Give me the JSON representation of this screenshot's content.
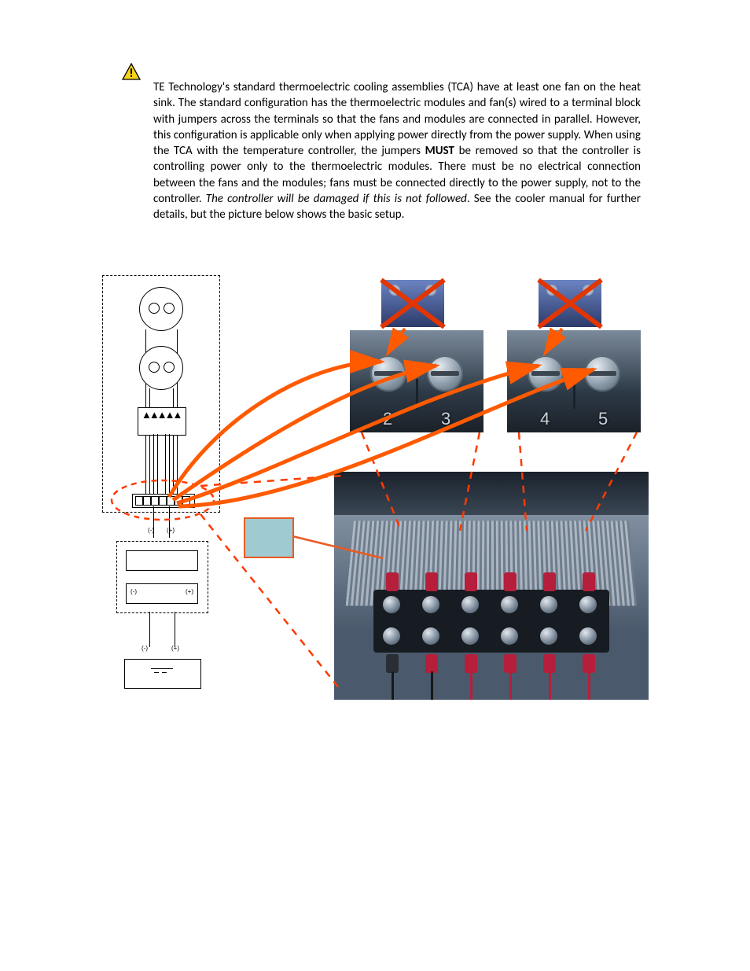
{
  "paragraph": {
    "pre": " TE Technology's standard thermoelectric cooling assemblies (TCA) have at least one fan on the heat sink. The standard configuration has the thermoelectric modules and fan(s) wired to a terminal block with jumpers across the terminals so that the fans and modules are connected in parallel. However, this configuration is applicable only when applying power directly from the power supply. When using the TCA with the temperature controller, the jumpers ",
    "must": "MUST",
    "mid": " be removed so that the controller is controlling power only to the thermoelectric modules. There must be no electrical connection between the fans and the modules; fans must be connected directly to the power supply, not to the controller. ",
    "italic": "The controller will be damaged if this is not followed",
    "post": ". See the cooler manual for further details, but the picture below shows the basic setup."
  },
  "terminals": {
    "left": {
      "a": "2",
      "b": "3"
    },
    "right": {
      "a": "4",
      "b": "5"
    }
  },
  "schematic_polarities": {
    "upper_left": "(-)",
    "upper_right": "(+)",
    "lower_left": "(-)",
    "lower_right": "(+)"
  },
  "icons": {
    "warning": "warning-triangle",
    "remove": "remove-x"
  }
}
